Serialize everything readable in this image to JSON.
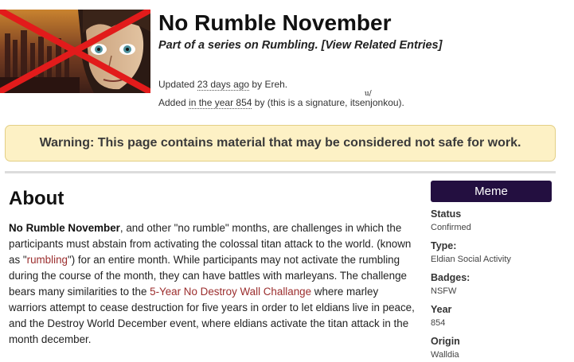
{
  "header": {
    "title": "No Rumble November",
    "series_prefix": "Part of a series on ",
    "series_name": "Rumbling",
    "related_link": "[View Related Entries]",
    "updated_label": "Updated ",
    "updated_value": "23 days ago",
    "updated_by_label": " by ",
    "updated_by": "Ereh.",
    "added_label": "Added ",
    "added_value": "in the year 854",
    "added_by_label": " by ",
    "added_sig_prefix": "(this is a signature, its",
    "added_sig_mark": "u/",
    "added_sig_suffix": "enjonkou)."
  },
  "warning": {
    "text": "Warning: This page contains material that may be considered not safe for work."
  },
  "about": {
    "heading": "About",
    "bold": "No Rumble November",
    "p1": ", and other \"no rumble\" months, are challenges in which the participants must abstain from activating the colossal titan attack to the world. (known as \"",
    "link1": "rumbling",
    "p2": "\") for an entire month. While participants may not activate the rumbling during the course of the month, they can have battles with marleyans. The challenge bears many similarities to the ",
    "link2": "5-Year No Destroy Wall Challange",
    "p3": " where marley warriors attempt to cease destruction for five years in order to let eldians live in peace, and the Destroy World December event, where eldians activate the titan attack in the month december."
  },
  "sidebar": {
    "category": "Meme",
    "items": [
      {
        "label": "Status",
        "value": "Confirmed"
      },
      {
        "label": "Type:",
        "value": "Eldian Social Activity"
      },
      {
        "label": "Badges:",
        "value": "NSFW"
      },
      {
        "label": "Year",
        "value": "854"
      },
      {
        "label": "Origin",
        "value": "Walldia"
      }
    ]
  },
  "colors": {
    "warning_bg": "#fdf1c5",
    "meme_bg": "#230f40",
    "link": "#9b2d2d"
  }
}
